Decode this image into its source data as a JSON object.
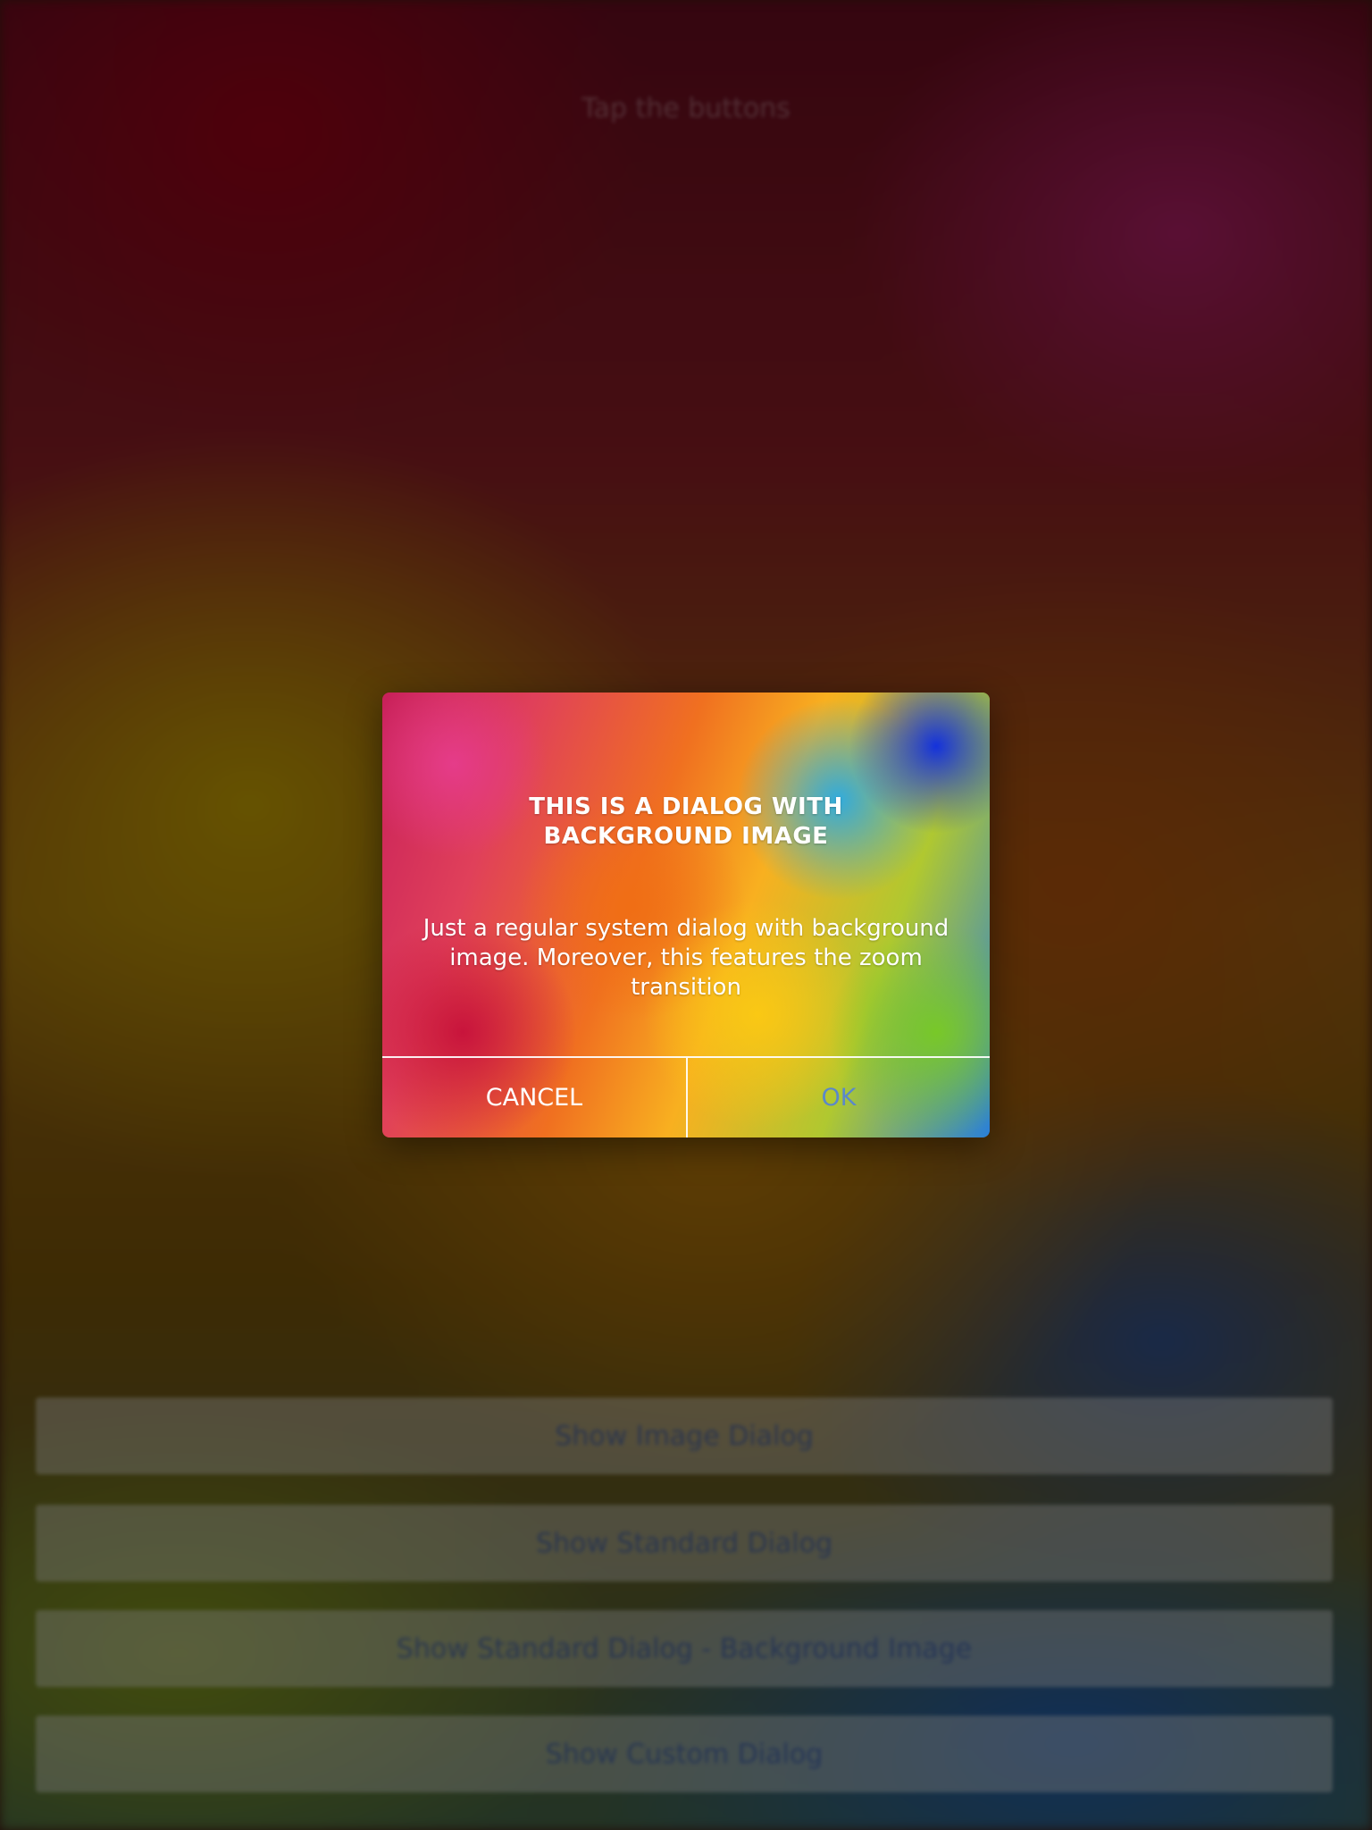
{
  "app": {
    "title": "Tap the buttons",
    "menu_buttons": [
      {
        "label": "Show Image Dialog"
      },
      {
        "label": "Show Standard Dialog"
      },
      {
        "label": "Show Standard Dialog - Background Image"
      },
      {
        "label": "Show Custom Dialog"
      }
    ]
  },
  "dialog": {
    "title": "THIS IS A DIALOG WITH\nBACKGROUND IMAGE",
    "message": "Just a regular system dialog with background image. Moreover, this features the zoom transition",
    "cancel_label": "CANCEL",
    "ok_label": "OK"
  },
  "colors": {
    "ok_button": "#5b88c9",
    "cancel_button": "#ffffff",
    "overlay": "rgba(0,0,0,0.42)"
  }
}
